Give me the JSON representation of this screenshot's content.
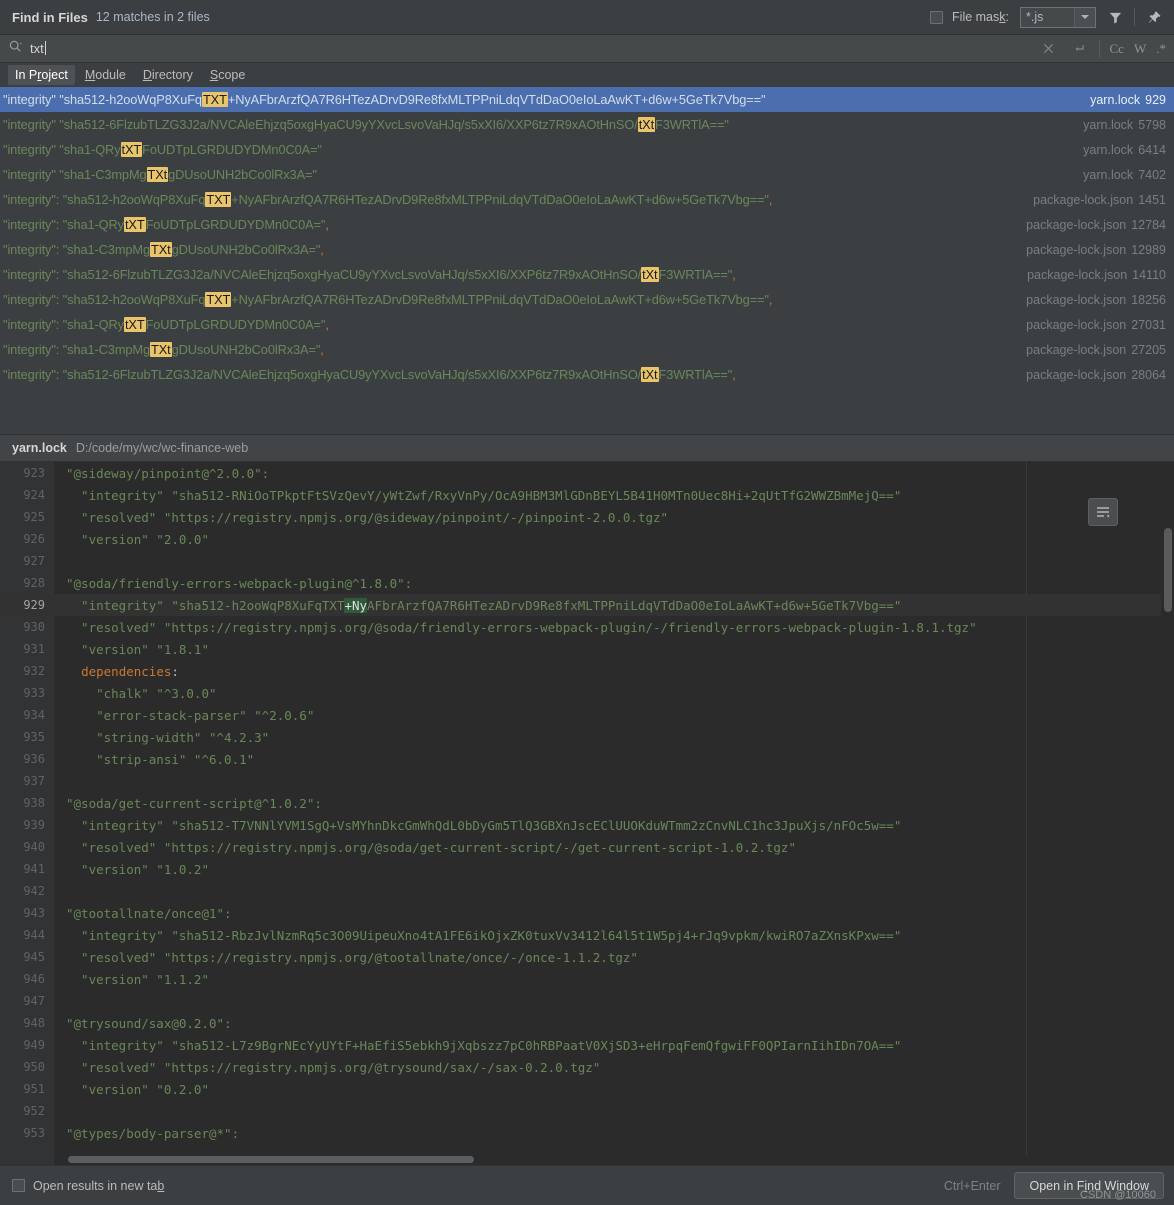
{
  "window": {
    "title": "Find in Files",
    "match_summary": "12 matches in 2 files"
  },
  "toolbar": {
    "file_mask_label": "File mask:",
    "file_mask_value": "*.js",
    "filter_icon": "filter-icon",
    "pin_icon": "pin-icon"
  },
  "search": {
    "value": "txt",
    "placeholder": "",
    "search_icon": "search-icon",
    "clear_icon": "close-icon",
    "history_icon": "return-icon",
    "options": [
      {
        "name": "match-case",
        "label": "Cc"
      },
      {
        "name": "words",
        "label": "W"
      },
      {
        "name": "regex",
        "label": ".*"
      }
    ]
  },
  "scope_tabs": [
    {
      "label": "In Project",
      "prefix": "In P",
      "mnemonic": "r",
      "suffix": "oject",
      "active": true
    },
    {
      "label": "Module",
      "prefix": "",
      "mnemonic": "M",
      "suffix": "odule",
      "active": false
    },
    {
      "label": "Directory",
      "prefix": "",
      "mnemonic": "D",
      "suffix": "irectory",
      "active": false
    },
    {
      "label": "Scope",
      "prefix": "",
      "mnemonic": "S",
      "suffix": "cope",
      "active": false
    }
  ],
  "results": [
    {
      "selected": true,
      "pre": "\"integrity\" \"sha512-h2ooWqP8XuFq",
      "match": "TXT",
      "post": "+NyAFbrArzfQA7R6HTezADrvD9Re8fxMLTPPniLdqVTdDaO0eIoLaAwKT+d6w+5GeTk7Vbg==\"",
      "file": "yarn.lock",
      "line": "929"
    },
    {
      "selected": false,
      "pre": "\"integrity\" \"sha512-6FlzubTLZG3J2a/NVCAleEhjzq5oxgHyaCU9yYXvcLsvoVaHJq/s5xXI6/XXP6tz7R9xAOtHnSO/",
      "match": "tXt",
      "post": "F3WRTlA==\"",
      "file": "yarn.lock",
      "line": "5798"
    },
    {
      "selected": false,
      "pre": "\"integrity\" \"sha1-QRy",
      "match": "tXT",
      "post": "FoUDTpLGRDUDYDMn0C0A=\"",
      "file": "yarn.lock",
      "line": "6414"
    },
    {
      "selected": false,
      "pre": "\"integrity\" \"sha1-C3mpMg",
      "match": "TXt",
      "post": "gDUsoUNH2bCo0lRx3A=\"",
      "file": "yarn.lock",
      "line": "7402"
    },
    {
      "selected": false,
      "pre": "\"integrity\": \"sha512-h2ooWqP8XuFq",
      "match": "TXT",
      "post": "+NyAFbrArzfQA7R6HTezADrvD9Re8fxMLTPPniLdqVTdDaO0eIoLaAwKT+d6w+5GeTk7Vbg==\",",
      "file": "package-lock.json",
      "line": "1451"
    },
    {
      "selected": false,
      "pre": "\"integrity\": \"sha1-QRy",
      "match": "tXT",
      "post": "FoUDTpLGRDUDYDMn0C0A=\",",
      "file": "package-lock.json",
      "line": "12784"
    },
    {
      "selected": false,
      "pre": "\"integrity\": \"sha1-C3mpMg",
      "match": "TXt",
      "post": "gDUsoUNH2bCo0lRx3A=\",",
      "file": "package-lock.json",
      "line": "12989"
    },
    {
      "selected": false,
      "pre": "\"integrity\": \"sha512-6FlzubTLZG3J2a/NVCAleEhjzq5oxgHyaCU9yYXvcLsvoVaHJq/s5xXI6/XXP6tz7R9xAOtHnSO/",
      "match": "tXt",
      "post": "F3WRTlA==\",",
      "file": "package-lock.json",
      "line": "14110"
    },
    {
      "selected": false,
      "pre": "\"integrity\": \"sha512-h2ooWqP8XuFq",
      "match": "TXT",
      "post": "+NyAFbrArzfQA7R6HTezADrvD9Re8fxMLTPPniLdqVTdDaO0eIoLaAwKT+d6w+5GeTk7Vbg==\",",
      "file": "package-lock.json",
      "line": "18256"
    },
    {
      "selected": false,
      "pre": "\"integrity\": \"sha1-QRy",
      "match": "tXT",
      "post": "FoUDTpLGRDUDYDMn0C0A=\",",
      "file": "package-lock.json",
      "line": "27031"
    },
    {
      "selected": false,
      "pre": "\"integrity\": \"sha1-C3mpMg",
      "match": "TXt",
      "post": "gDUsoUNH2bCo0lRx3A=\",",
      "file": "package-lock.json",
      "line": "27205"
    },
    {
      "selected": false,
      "pre": "\"integrity\": \"sha512-6FlzubTLZG3J2a/NVCAleEhjzq5oxgHyaCU9yYXvcLsvoVaHJq/s5xXI6/XXP6tz7R9xAOtHnSO/",
      "match": "tXt",
      "post": "F3WRTlA==\",",
      "file": "package-lock.json",
      "line": "28064"
    }
  ],
  "preview": {
    "file": "yarn.lock",
    "path": "D:/code/my/wc/wc-finance-web",
    "soft_wrap_icon": "soft-wrap-icon",
    "lines": [
      {
        "no": "923",
        "text": "\"@sideway/pinpoint@^2.0.0\":",
        "current": false
      },
      {
        "no": "924",
        "text": "  \"integrity\" \"sha512-RNiOoTPkptFtSVzQevY/yWtZwf/RxyVnPy/OcA9HBM3MlGDnBEYL5B41H0MTn0Uec8Hi+2qUtTfG2WWZBmMejQ==\"",
        "current": false
      },
      {
        "no": "925",
        "text": "  \"resolved\" \"https://registry.npmjs.org/@sideway/pinpoint/-/pinpoint-2.0.0.tgz\"",
        "current": false
      },
      {
        "no": "926",
        "text": "  \"version\" \"2.0.0\"",
        "current": false
      },
      {
        "no": "927",
        "text": "",
        "current": false
      },
      {
        "no": "928",
        "text": "\"@soda/friendly-errors-webpack-plugin@^1.8.0\":",
        "current": false
      },
      {
        "no": "929",
        "text": "  \"integrity\" \"sha512-h2ooWqP8XuFqTXT+NyAFbrArzfQA7R6HTezADrvD9Re8fxMLTPPniLdqVTdDaO0eIoLaAwKT+d6w+5GeTk7Vbg==\"",
        "current": true,
        "hl_start": 37,
        "hl_len": 3
      },
      {
        "no": "930",
        "text": "  \"resolved\" \"https://registry.npmjs.org/@soda/friendly-errors-webpack-plugin/-/friendly-errors-webpack-plugin-1.8.1.tgz\"",
        "current": false
      },
      {
        "no": "931",
        "text": "  \"version\" \"1.8.1\"",
        "current": false
      },
      {
        "no": "932",
        "text": "  dependencies:",
        "current": false,
        "keyword": "dependencies"
      },
      {
        "no": "933",
        "text": "    \"chalk\" \"^3.0.0\"",
        "current": false
      },
      {
        "no": "934",
        "text": "    \"error-stack-parser\" \"^2.0.6\"",
        "current": false
      },
      {
        "no": "935",
        "text": "    \"string-width\" \"^4.2.3\"",
        "current": false
      },
      {
        "no": "936",
        "text": "    \"strip-ansi\" \"^6.0.1\"",
        "current": false
      },
      {
        "no": "937",
        "text": "",
        "current": false
      },
      {
        "no": "938",
        "text": "\"@soda/get-current-script@^1.0.2\":",
        "current": false
      },
      {
        "no": "939",
        "text": "  \"integrity\" \"sha512-T7VNNlYVM1SgQ+VsMYhnDkcGmWhQdL0bDyGm5TlQ3GBXnJscEClUUOKduWTmm2zCnvNLC1hc3JpuXjs/nFOc5w==\"",
        "current": false
      },
      {
        "no": "940",
        "text": "  \"resolved\" \"https://registry.npmjs.org/@soda/get-current-script/-/get-current-script-1.0.2.tgz\"",
        "current": false
      },
      {
        "no": "941",
        "text": "  \"version\" \"1.0.2\"",
        "current": false
      },
      {
        "no": "942",
        "text": "",
        "current": false
      },
      {
        "no": "943",
        "text": "\"@tootallnate/once@1\":",
        "current": false
      },
      {
        "no": "944",
        "text": "  \"integrity\" \"sha512-RbzJvlNzmRq5c3O09UipeuXno4tA1FE6ikOjxZK0tuxVv3412l64l5t1W5pj4+rJq9vpkm/kwiRO7aZXnsKPxw==\"",
        "current": false
      },
      {
        "no": "945",
        "text": "  \"resolved\" \"https://registry.npmjs.org/@tootallnate/once/-/once-1.1.2.tgz\"",
        "current": false
      },
      {
        "no": "946",
        "text": "  \"version\" \"1.1.2\"",
        "current": false
      },
      {
        "no": "947",
        "text": "",
        "current": false
      },
      {
        "no": "948",
        "text": "\"@trysound/sax@0.2.0\":",
        "current": false
      },
      {
        "no": "949",
        "text": "  \"integrity\" \"sha512-L7z9BgrNEcYyUYtF+HaEfiS5ebkh9jXqbszz7pC0hRBPaatV0XjSD3+eHrpqFemQfgwiFF0QPIarnIihIDn7OA==\"",
        "current": false
      },
      {
        "no": "950",
        "text": "  \"resolved\" \"https://registry.npmjs.org/@trysound/sax/-/sax-0.2.0.tgz\"",
        "current": false
      },
      {
        "no": "951",
        "text": "  \"version\" \"0.2.0\"",
        "current": false
      },
      {
        "no": "952",
        "text": "",
        "current": false
      },
      {
        "no": "953",
        "text": "\"@types/body-parser@*\":",
        "current": false
      }
    ]
  },
  "footer": {
    "open_new_tab_prefix": "Open results in new ta",
    "open_new_tab_mnemonic": "b",
    "shortcut": "Ctrl+Enter",
    "button_prefix": "Open in F",
    "button_mnemonic": "i",
    "button_suffix": "nd Window"
  },
  "watermark": "CSDN @10060",
  "colors": {
    "selection": "#4b6eaf",
    "highlight": "#e9c46a",
    "editor_highlight": "#32593d",
    "string": "#6a8759",
    "keyword": "#cc7832",
    "background": "#3c3f41",
    "editor_background": "#2b2b2b"
  }
}
